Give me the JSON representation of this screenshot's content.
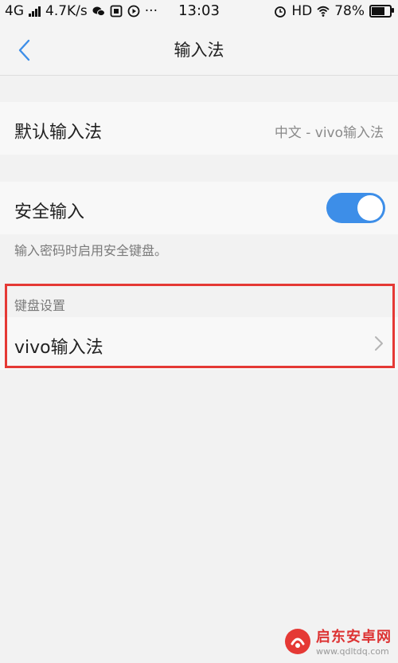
{
  "status_bar": {
    "network": "4G",
    "speed": "4.7K/s",
    "more": "···",
    "time": "13:03",
    "hd": "HD",
    "battery_text": "78%",
    "battery_level": 0.78
  },
  "header": {
    "title": "输入法"
  },
  "default_input": {
    "label": "默认输入法",
    "value": "中文 - vivo输入法"
  },
  "secure_input": {
    "label": "安全输入",
    "enabled": true,
    "hint": "输入密码时启用安全键盘。"
  },
  "keyboard_settings": {
    "section_title": "键盘设置",
    "item_label": "vivo输入法"
  },
  "watermark": {
    "title": "启东安卓网",
    "url": "www.qdltdq.com"
  },
  "colors": {
    "accent": "#3d8ee8",
    "highlight": "#e53935"
  }
}
